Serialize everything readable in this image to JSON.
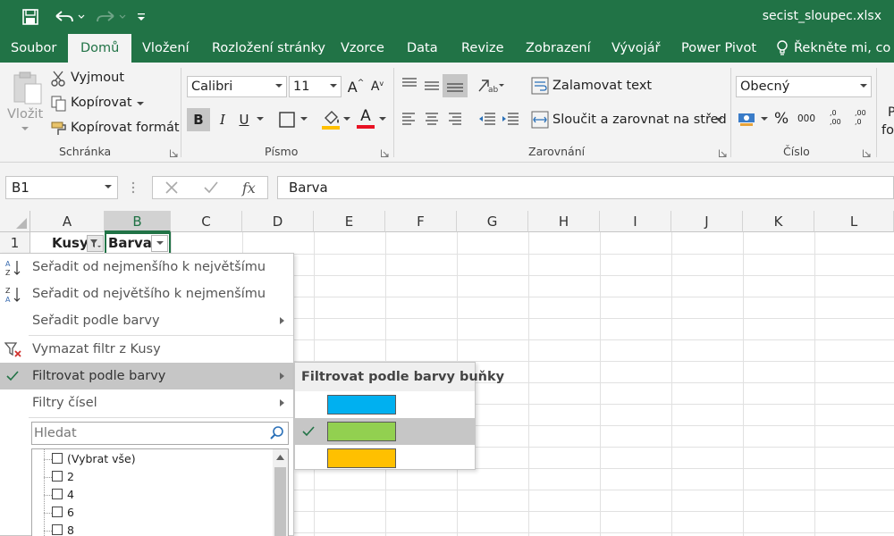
{
  "window": {
    "file_title": "secist_sloupec.xlsx"
  },
  "tabs": [
    "Soubor",
    "Domů",
    "Vložení",
    "Rozložení stránky",
    "Vzorce",
    "Data",
    "Revize",
    "Zobrazení",
    "Vývojář",
    "Power Pivot"
  ],
  "active_tab": "Domů",
  "tell_me": "Řekněte mi, co ch",
  "ribbon": {
    "clipboard": {
      "paste": "Vložit",
      "cut": "Vyjmout",
      "copy": "Kopírovat",
      "format_painter": "Kopírovat formát",
      "label": "Schránka"
    },
    "font": {
      "name": "Calibri",
      "size": "11",
      "bold": "B",
      "italic": "I",
      "underline": "U",
      "grow": "A",
      "shrink": "A",
      "color_letter": "A",
      "label": "Písmo"
    },
    "alignment": {
      "wrap": "Zalamovat text",
      "merge": "Sloučit a zarovnat na střed",
      "label": "Zarovnání"
    },
    "number": {
      "format": "Obecný",
      "percent": "%",
      "thousands": "000",
      "label": "Číslo",
      "dec_more": ",0 ,00",
      "dec_less": ",00 ,0"
    },
    "styles_partial": {
      "line1": "P",
      "line2": "fo"
    }
  },
  "formula_bar": {
    "name_box": "B1",
    "formula": "Barva",
    "fx": "fx"
  },
  "columns": [
    "A",
    "B",
    "C",
    "D",
    "E",
    "F",
    "G",
    "H",
    "I",
    "J",
    "K",
    "L"
  ],
  "selected_column": "B",
  "rows": [
    "1"
  ],
  "cells": {
    "A1": "Kusy",
    "B1": "Barva"
  },
  "filter_menu": {
    "items": [
      {
        "label": "Seřadit od nejmenšího k největšímu",
        "icon": "sort-ascending-icon"
      },
      {
        "label": "Seřadit od největšího k nejmenšímu",
        "icon": "sort-descending-icon"
      },
      {
        "label": "Seřadit podle barvy",
        "submenu": true
      },
      {
        "label": "Vymazat filtr z Kusy",
        "icon": "clear-filter-icon"
      },
      {
        "label": "Filtrovat podle barvy",
        "submenu": true,
        "checked": true,
        "highlighted": true
      },
      {
        "label": "Filtry čísel",
        "submenu": true
      }
    ],
    "search_placeholder": "Hledat",
    "list": [
      "(Vybrat vše)",
      "2",
      "4",
      "6",
      "8"
    ]
  },
  "color_submenu": {
    "title": "Filtrovat podle barvy buňky",
    "colors": [
      "#00b0f0",
      "#92d050",
      "#ffc000"
    ],
    "selected_index": 1
  },
  "colors": {
    "excel_green": "#217346",
    "ribbon_bg": "#f3f3f3",
    "font_color_bar": "#e81123",
    "fill_color_bar": "#ffc000"
  }
}
